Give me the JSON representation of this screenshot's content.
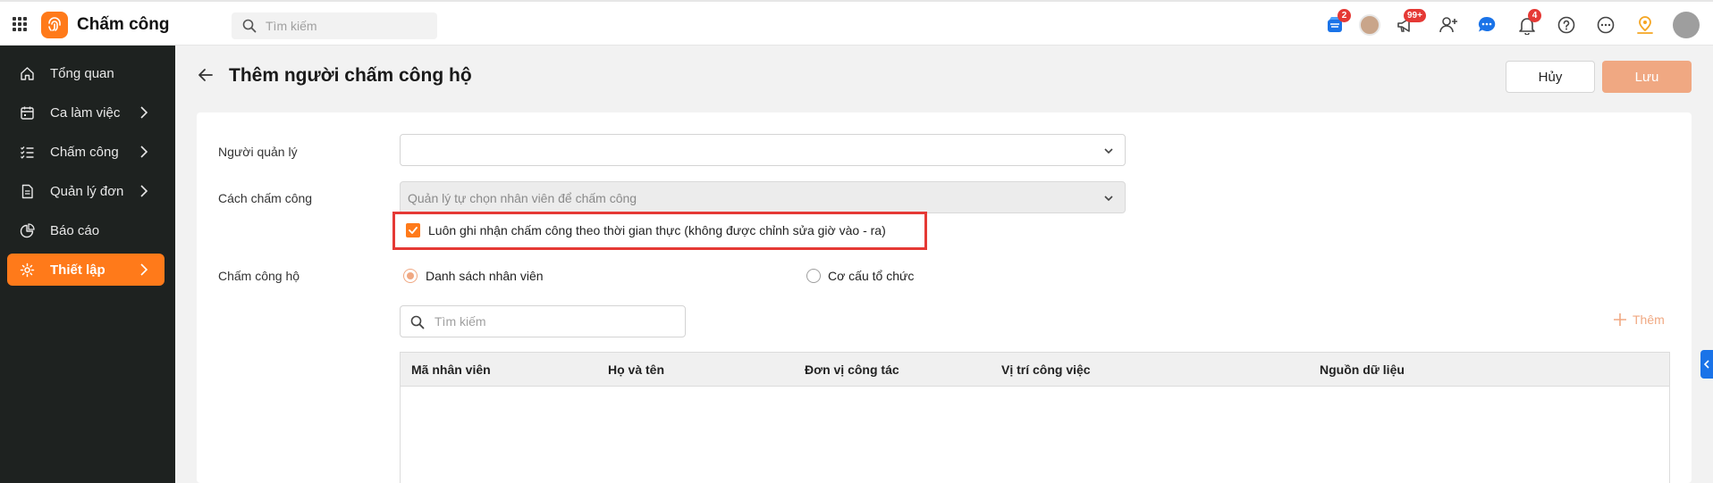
{
  "header": {
    "app_title": "Chấm công",
    "search_placeholder": "Tìm kiếm",
    "badges": {
      "store": "2",
      "megaphone": "99+",
      "bell": "4"
    },
    "icons": [
      "apps-grid-icon",
      "store-icon",
      "avatar",
      "megaphone-icon",
      "add-user-icon",
      "chat-icon",
      "bell-icon",
      "help-icon",
      "more-icon",
      "location-icon",
      "qr-avatar"
    ]
  },
  "sidebar": {
    "items": [
      {
        "label": "Tổng quan",
        "icon": "home-icon"
      },
      {
        "label": "Ca làm việc",
        "icon": "calendar-icon"
      },
      {
        "label": "Chấm công",
        "icon": "checklist-icon"
      },
      {
        "label": "Quản lý đơn",
        "icon": "document-icon"
      },
      {
        "label": "Báo cáo",
        "icon": "pie-chart-icon"
      },
      {
        "label": "Thiết lập",
        "icon": "gear-icon"
      }
    ]
  },
  "page": {
    "title": "Thêm người chấm công hộ",
    "cancel_label": "Hủy",
    "save_label": "Lưu"
  },
  "form": {
    "manager_label": "Người quản lý",
    "manager_value": "",
    "method_label": "Cách chấm công",
    "method_value": "Quản lý tự chọn nhân viên để chấm công",
    "realtime_label": "Luôn ghi nhận chấm công theo thời gian thực (không được chỉnh sửa giờ vào - ra)",
    "realtime_checked": true,
    "proxy_label": "Chấm công hộ",
    "option_employees": "Danh sách nhân viên",
    "option_org": "Cơ cấu tổ chức",
    "selected_option": "Danh sách nhân viên",
    "search_placeholder": "Tìm kiếm",
    "add_label": "Thêm"
  },
  "table": {
    "columns": [
      "Mã nhân viên",
      "Họ và tên",
      "Đơn vị công tác",
      "Vị trí công việc",
      "Nguồn dữ liệu"
    ],
    "rows": []
  },
  "colors": {
    "accent": "#ff7a1a",
    "accent_light": "#f0a882",
    "sidebar_bg": "#1e2220",
    "highlight": "#e53935"
  }
}
